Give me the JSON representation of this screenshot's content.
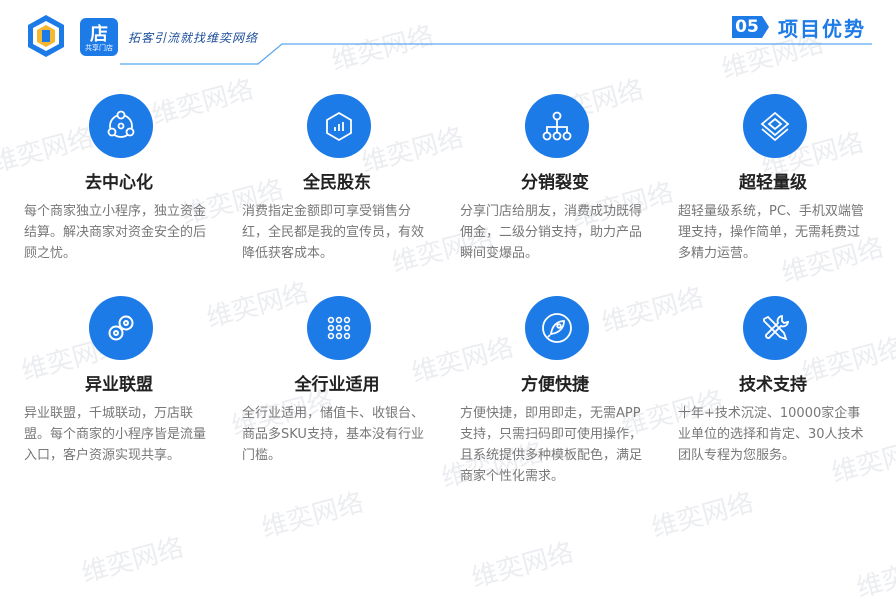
{
  "header": {
    "app_badge_top": "店",
    "app_badge_bottom": "共享门店",
    "slogan": "拓客引流就找维奕网络",
    "section_number": "05",
    "section_title": "项目优势"
  },
  "watermark_text": "维奕网络",
  "colors": {
    "accent": "#1d7be8",
    "title": "#222222",
    "desc": "#777777"
  },
  "features": [
    {
      "icon": "network-icon",
      "title": "去中心化",
      "desc": "每个商家独立小程序，独立资金结算。解决商家对资金安全的后顾之忧。"
    },
    {
      "icon": "chart-box-icon",
      "title": "全民股东",
      "desc": "消费指定金额即可享受销售分红，全民都是我的宣传员，有效降低获客成本。"
    },
    {
      "icon": "hierarchy-icon",
      "title": "分销裂变",
      "desc": "分享门店给朋友，消费成功既得佣金，二级分销支持，助力产品瞬间变爆品。"
    },
    {
      "icon": "layers-icon",
      "title": "超轻量级",
      "desc": "超轻量级系统，PC、手机双端管理支持，操作简单，无需耗费过多精力运营。"
    },
    {
      "icon": "link-icon",
      "title": "异业联盟",
      "desc": "异业联盟，千城联动，万店联盟。每个商家的小程序皆是流量入口，客户资源实现共享。"
    },
    {
      "icon": "grid-dots-icon",
      "title": "全行业适用",
      "desc": "全行业适用，储值卡、收银台、商品多SKU支持，基本没有行业门槛。"
    },
    {
      "icon": "rocket-icon",
      "title": "方便快捷",
      "desc": "方便快捷，即用即走，无需APP支持，只需扫码即可使用操作，且系统提供多种模板配色，满足商家个性化需求。"
    },
    {
      "icon": "tools-icon",
      "title": "技术支持",
      "desc": "十年+技术沉淀、10000家企事业单位的选择和肯定、30人技术团队专程为您服务。"
    }
  ]
}
